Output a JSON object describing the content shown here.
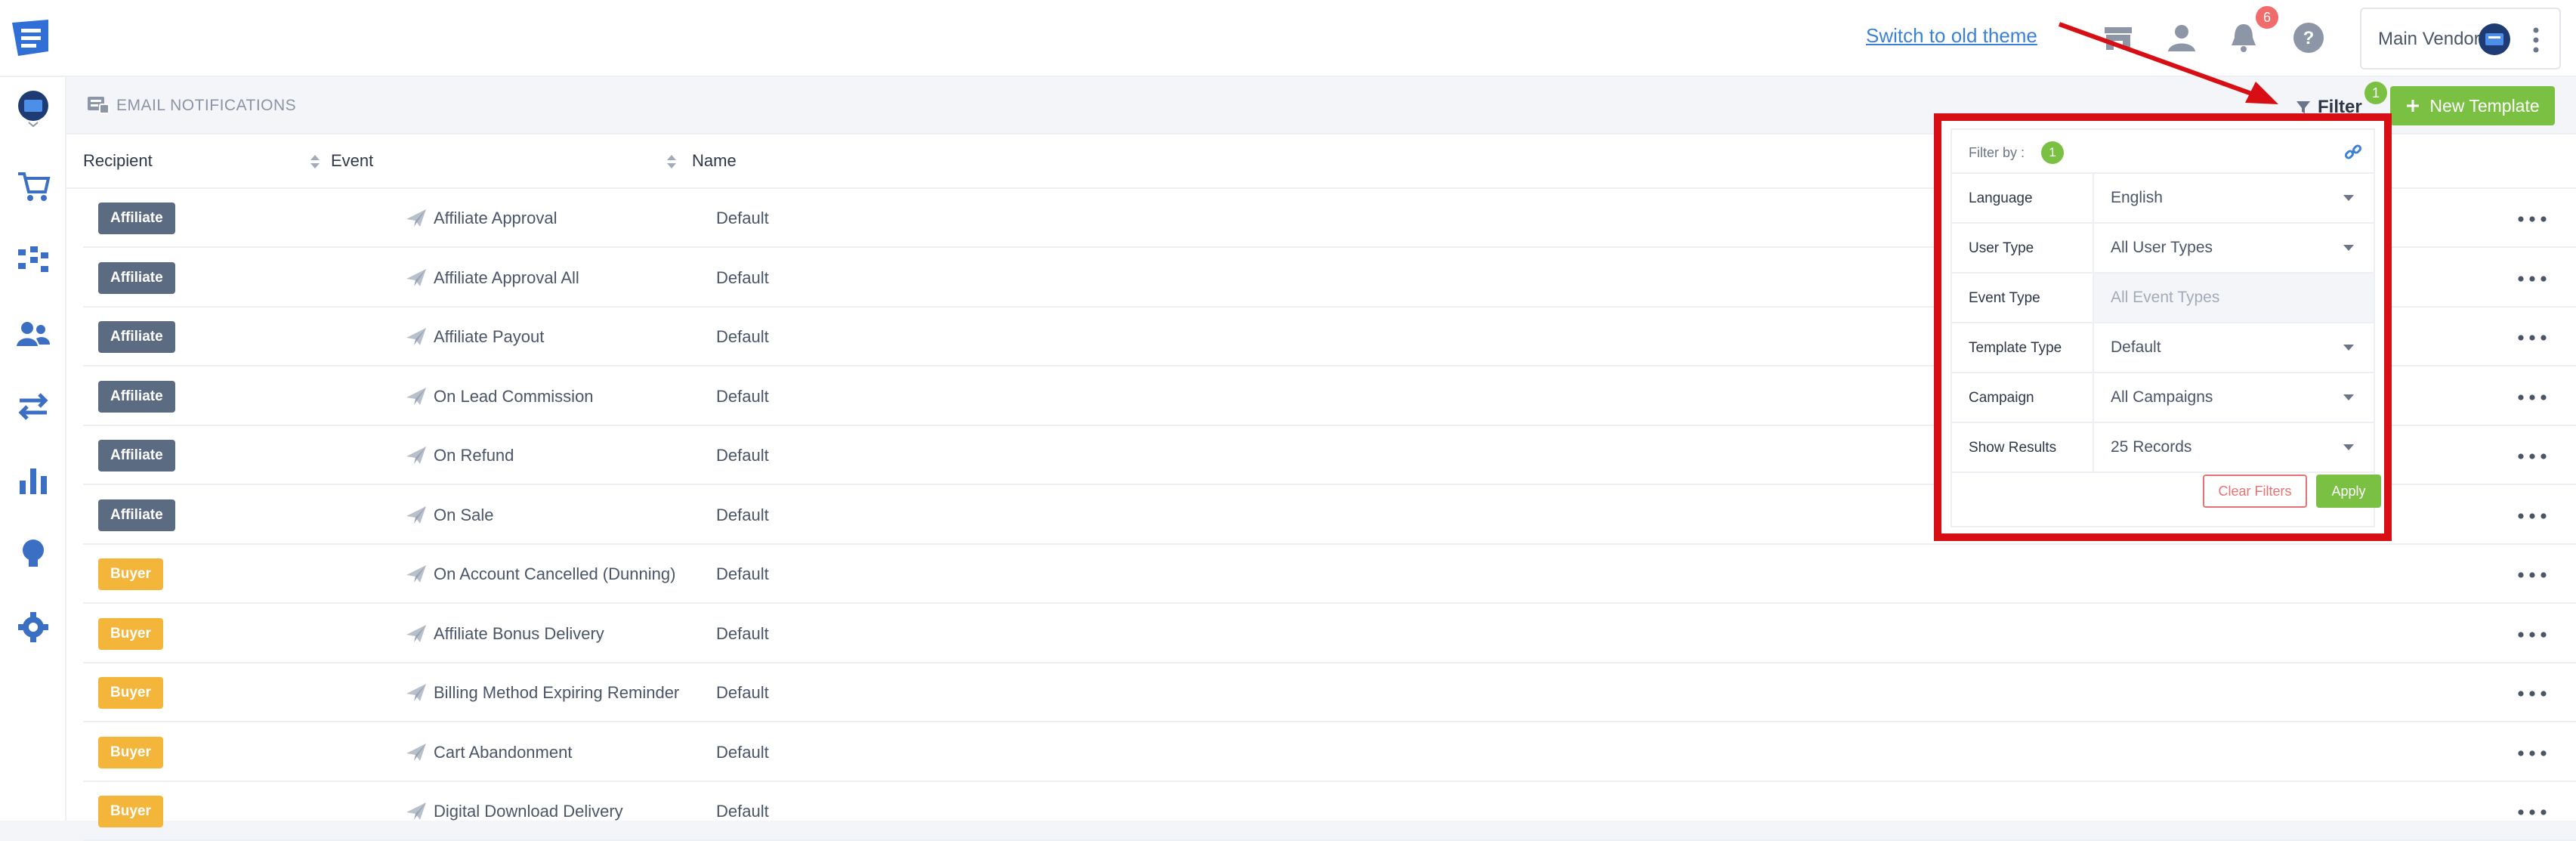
{
  "topbar": {
    "old_theme_link": "Switch to old theme",
    "notifications_count": "6",
    "vendor_name": "Main Vendor",
    "icons": [
      "store-icon",
      "user-icon",
      "bell-icon",
      "help-icon"
    ]
  },
  "sidebar": {
    "items": [
      "vendor-avatar-icon",
      "cart-icon",
      "funnel-icon",
      "users-icon",
      "transfer-icon",
      "chart-icon",
      "lightbulb-icon",
      "settings-icon"
    ]
  },
  "subheader": {
    "title": "EMAIL NOTIFICATIONS",
    "filter_label": "Filter",
    "filter_count": "1",
    "new_template_label": "New Template"
  },
  "table": {
    "headers": {
      "recipient": "Recipient",
      "event": "Event",
      "name": "Name"
    },
    "rows": [
      {
        "recipient": "Affiliate",
        "event": "Affiliate Approval",
        "name": "Default"
      },
      {
        "recipient": "Affiliate",
        "event": "Affiliate Approval All",
        "name": "Default"
      },
      {
        "recipient": "Affiliate",
        "event": "Affiliate Payout",
        "name": "Default"
      },
      {
        "recipient": "Affiliate",
        "event": "On Lead Commission",
        "name": "Default"
      },
      {
        "recipient": "Affiliate",
        "event": "On Refund",
        "name": "Default"
      },
      {
        "recipient": "Affiliate",
        "event": "On Sale",
        "name": "Default"
      },
      {
        "recipient": "Buyer",
        "event": "On Account Cancelled (Dunning)",
        "name": "Default"
      },
      {
        "recipient": "Buyer",
        "event": "Affiliate Bonus Delivery",
        "name": "Default"
      },
      {
        "recipient": "Buyer",
        "event": "Billing Method Expiring Reminder",
        "name": "Default"
      },
      {
        "recipient": "Buyer",
        "event": "Cart Abandonment",
        "name": "Default"
      },
      {
        "recipient": "Buyer",
        "event": "Digital Download Delivery",
        "name": "Default"
      }
    ]
  },
  "filter_panel": {
    "title": "Filter by :",
    "count": "1",
    "fields": [
      {
        "label": "Language",
        "value": "English",
        "disabled": false
      },
      {
        "label": "User Type",
        "value": "All User Types",
        "disabled": false
      },
      {
        "label": "Event Type",
        "value": "All Event Types",
        "disabled": true
      },
      {
        "label": "Template Type",
        "value": "Default",
        "disabled": false
      },
      {
        "label": "Campaign",
        "value": "All Campaigns",
        "disabled": false
      },
      {
        "label": "Show Results",
        "value": "25 Records",
        "disabled": false
      }
    ],
    "clear_label": "Clear Filters",
    "apply_label": "Apply"
  },
  "colors": {
    "accent_green": "#7ac143",
    "link_blue": "#3b82d6",
    "affiliate_badge": "#5b6b82",
    "buyer_badge": "#f3b63a",
    "highlight_red": "#d70f14"
  }
}
